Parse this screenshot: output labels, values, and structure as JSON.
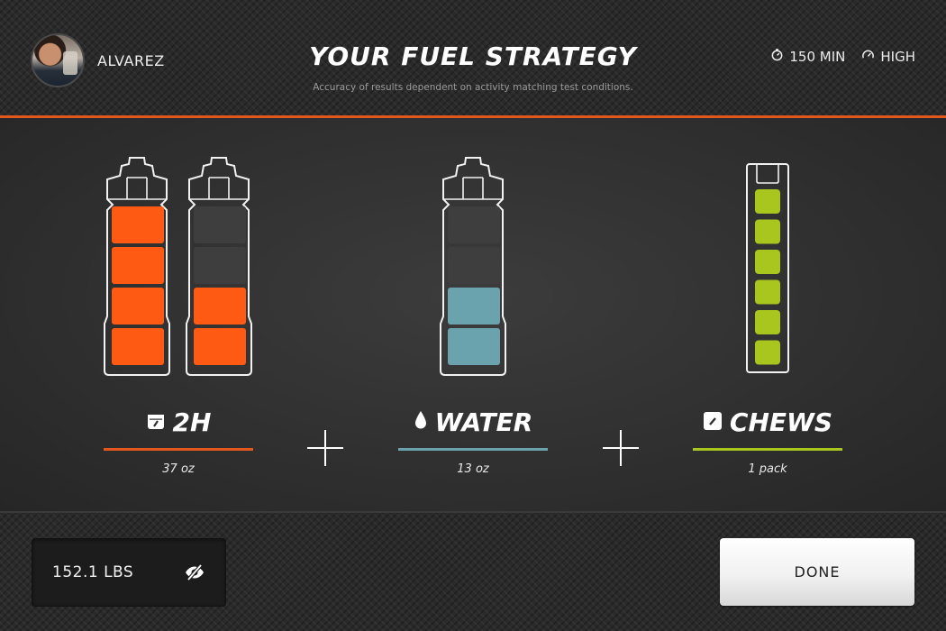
{
  "header": {
    "username": "ALVAREZ",
    "title": "YOUR FUEL STRATEGY",
    "subtitle": "Accuracy of results dependent on activity matching test conditions.",
    "duration": "150 MIN",
    "intensity": "HIGH"
  },
  "items": [
    {
      "name": "2H",
      "amount": "37 oz",
      "icon": "drink-mix-icon",
      "color": "#ff5a14",
      "bottles_filled_segments": [
        4,
        2
      ],
      "segments_per_bottle": 4
    },
    {
      "name": "WATER",
      "amount": "13 oz",
      "icon": "water-drop-icon",
      "color": "#6aa3ad",
      "bottles_filled_segments": [
        2
      ],
      "segments_per_bottle": 4
    },
    {
      "name": "CHEWS",
      "amount": "1 pack",
      "icon": "chews-icon",
      "color": "#a9c61f",
      "chews_filled": 6
    }
  ],
  "footer": {
    "weight": "152.1 LBS",
    "done_label": "DONE"
  },
  "colors": {
    "accent": "#e2571e",
    "empty_segment": "#3e3e3e"
  }
}
